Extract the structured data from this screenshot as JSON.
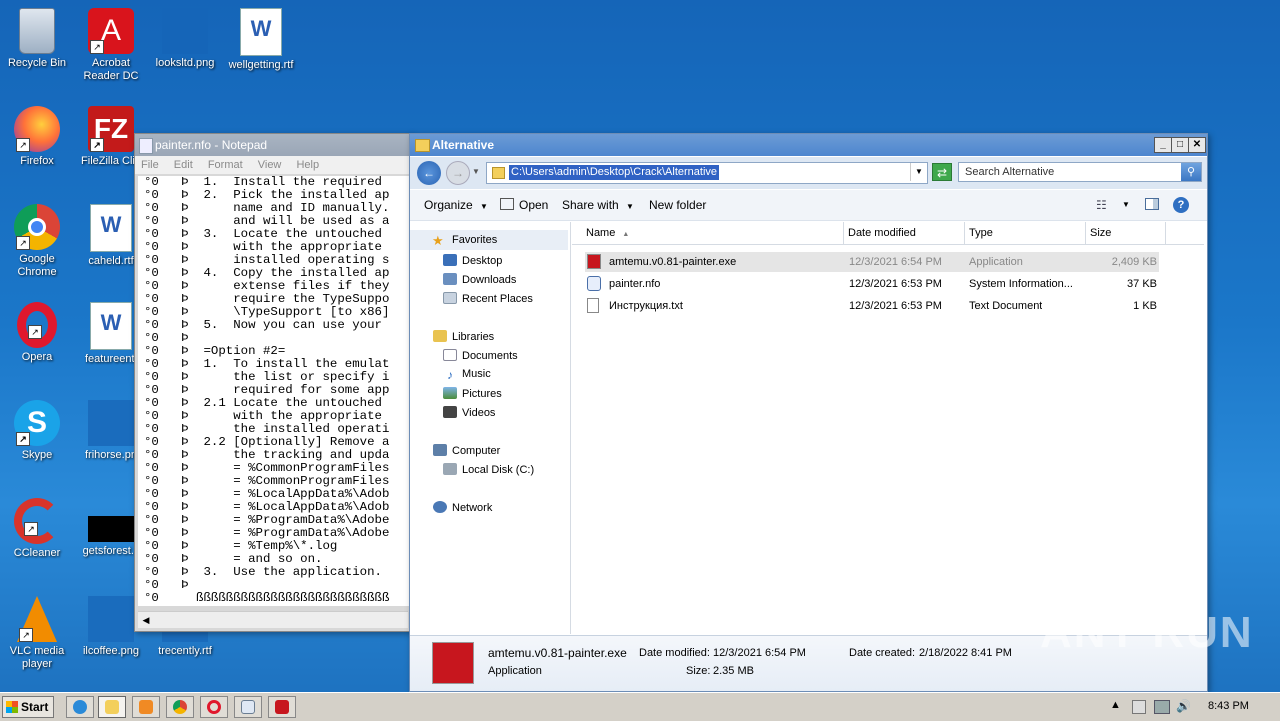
{
  "desktop": {
    "icons": [
      {
        "label": "Recycle Bin"
      },
      {
        "label": "Acrobat Reader DC"
      },
      {
        "label": "looksltd.png"
      },
      {
        "label": "wellgetting.rtf"
      },
      {
        "label": "Firefox"
      },
      {
        "label": "FileZilla Clie"
      },
      {
        "label": "Google Chrome"
      },
      {
        "label": "caheld.rtf"
      },
      {
        "label": "Opera"
      },
      {
        "label": "featureenti"
      },
      {
        "label": "Skype"
      },
      {
        "label": "frihorse.pn"
      },
      {
        "label": "CCleaner"
      },
      {
        "label": "getsforest.s"
      },
      {
        "label": "VLC media player"
      },
      {
        "label": "ilcoffee.png"
      },
      {
        "label": "trecently.rtf"
      }
    ]
  },
  "notepad": {
    "title": "painter.nfo - Notepad",
    "menu": [
      "File",
      "Edit",
      "Format",
      "View",
      "Help"
    ],
    "lines": [
      "°0   Þ  1.  Install the required",
      "°0   Þ  2.  Pick the installed ap",
      "°0   Þ      name and ID manually.",
      "°0   Þ      and will be used as a",
      "°0   Þ  3.  Locate the untouched",
      "°0   Þ      with the appropriate",
      "°0   Þ      installed operating s",
      "°0   Þ  4.  Copy the installed ap",
      "°0   Þ      extense files if they",
      "°0   Þ      require the TypeSuppo",
      "°0   Þ      \\TypeSupport [to x86]",
      "°0   Þ  5.  Now you can use your",
      "°0   Þ",
      "°0   Þ  =Option #2=",
      "°0   Þ  1.  To install the emulat",
      "°0   Þ      the list or specify i",
      "°0   Þ      required for some app",
      "°0   Þ  2.1 Locate the untouched",
      "°0   Þ      with the appropriate",
      "°0   Þ      the installed operati",
      "°0   Þ  2.2 [Optionally] Remove a",
      "°0   Þ      the tracking and upda",
      "°0   Þ      = %CommonProgramFiles",
      "°0   Þ      = %CommonProgramFiles",
      "°0   Þ      = %LocalAppData%\\Adob",
      "°0   Þ      = %LocalAppData%\\Adob",
      "°0   Þ      = %ProgramData%\\Adobe",
      "°0   Þ      = %ProgramData%\\Adobe",
      "°0   Þ      = %Temp%\\*.log",
      "°0   Þ      = and so on.",
      "°0   Þ  3.  Use the application.",
      "°0   Þ",
      "°0     ßßßßßßßßßßßßßßßßßßßßßßßßßß"
    ]
  },
  "explorer": {
    "title": "Alternative",
    "address": "C:\\Users\\admin\\Desktop\\Crack\\Alternative",
    "search_placeholder": "Search Alternative",
    "toolbar": {
      "organize": "Organize",
      "open": "Open",
      "share": "Share with",
      "new_folder": "New folder"
    },
    "nav": {
      "favorites": "Favorites",
      "desktop": "Desktop",
      "downloads": "Downloads",
      "recent": "Recent Places",
      "libraries": "Libraries",
      "documents": "Documents",
      "music": "Music",
      "pictures": "Pictures",
      "videos": "Videos",
      "computer": "Computer",
      "local_disk": "Local Disk (C:)",
      "network": "Network"
    },
    "columns": {
      "name": "Name",
      "date": "Date modified",
      "type": "Type",
      "size": "Size"
    },
    "files": [
      {
        "name": "amtemu.v0.81-painter.exe",
        "date": "12/3/2021 6:54 PM",
        "type": "Application",
        "size": "2,409 KB"
      },
      {
        "name": "painter.nfo",
        "date": "12/3/2021 6:53 PM",
        "type": "System Information...",
        "size": "37 KB"
      },
      {
        "name": "Инструкция.txt",
        "date": "12/3/2021 6:53 PM",
        "type": "Text Document",
        "size": "1 KB"
      }
    ],
    "details": {
      "name": "amtemu.v0.81-painter.exe",
      "kind": "Application",
      "modified_label": "Date modified:",
      "modified": "12/3/2021 6:54 PM",
      "size_label": "Size:",
      "size": "2.35 MB",
      "created_label": "Date created:",
      "created": "2/18/2022 8:41 PM"
    }
  },
  "taskbar": {
    "start": "Start",
    "clock": "8:43 PM"
  },
  "watermark": "ANY RUN"
}
